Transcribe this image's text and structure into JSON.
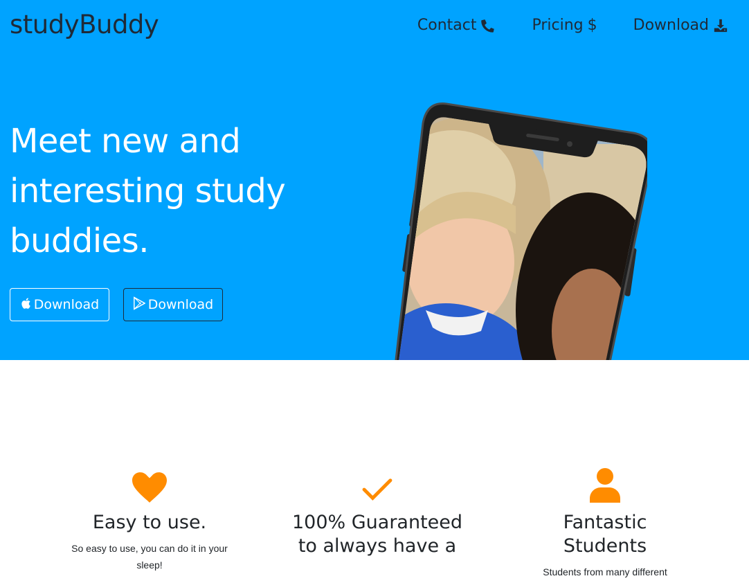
{
  "navbar": {
    "brand": "studyBuddy",
    "links": [
      {
        "label": "Contact",
        "icon": "phone-icon"
      },
      {
        "label": "Pricing",
        "icon": "dollar-icon"
      },
      {
        "label": "Download",
        "icon": "download-icon"
      }
    ]
  },
  "hero": {
    "headline": "Meet new and interesting study buddies.",
    "buttons": [
      {
        "label": "Download",
        "icon": "apple-icon"
      },
      {
        "label": "Download",
        "icon": "google-play-icon"
      }
    ],
    "background_color": "#00a3ff",
    "image": "phone-with-two-students"
  },
  "features": [
    {
      "icon": "heart-icon",
      "title": "Easy to use.",
      "text": "So easy to use, you can do it in your sleep!"
    },
    {
      "icon": "check-icon",
      "title": "100% Guaranteed to always have a",
      "text": ""
    },
    {
      "icon": "user-icon",
      "title": "Fantastic Students",
      "text": "Students from many different"
    }
  ],
  "colors": {
    "accent": "#ff8c00",
    "hero_bg": "#00a3ff",
    "brand_text": "#1f2a37"
  }
}
